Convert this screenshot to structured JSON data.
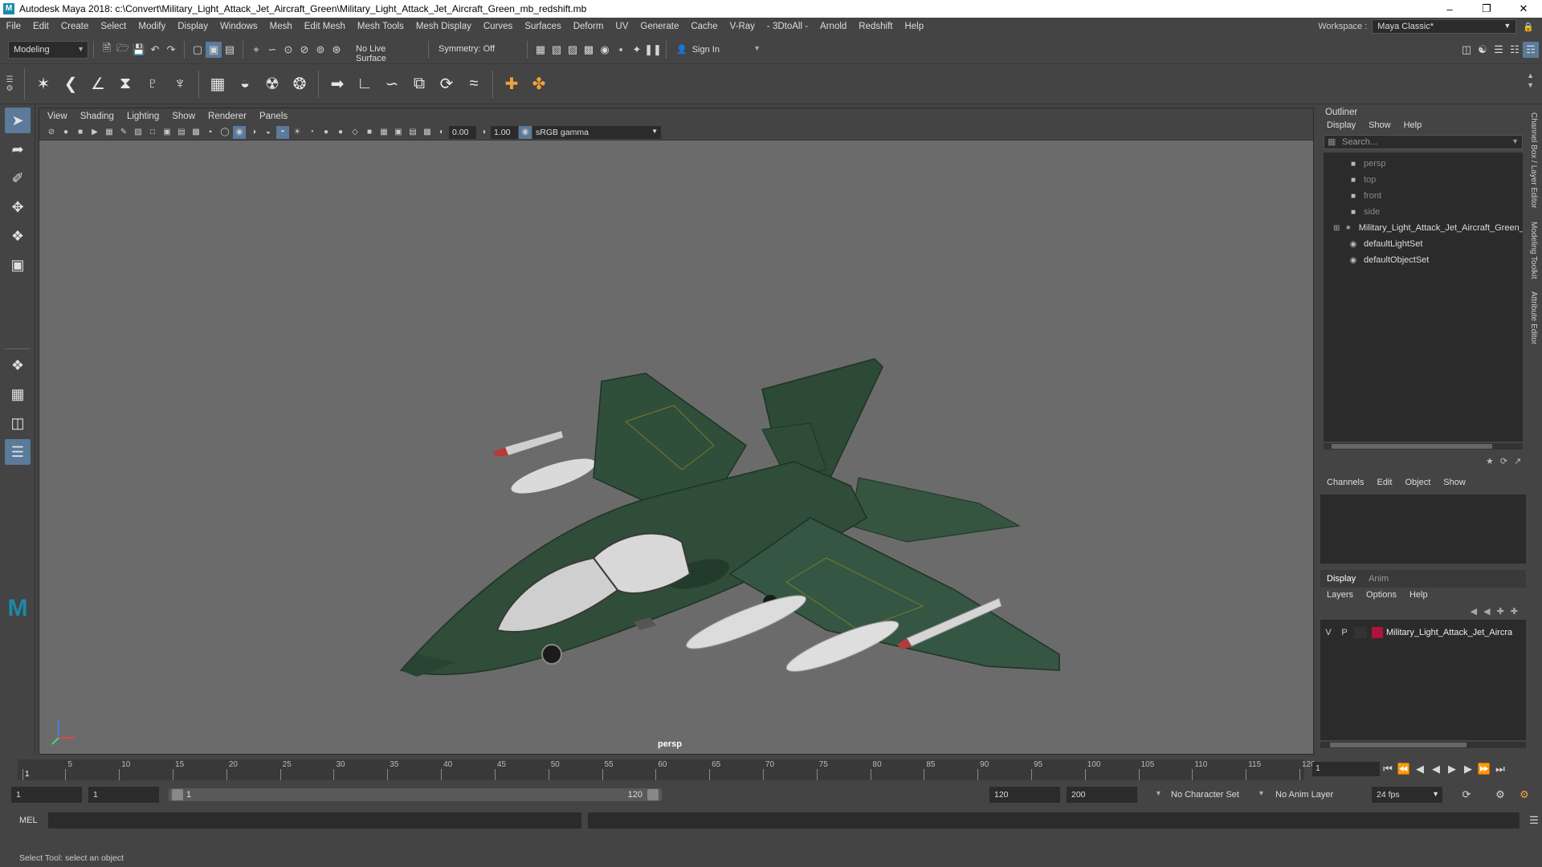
{
  "titlebar": {
    "title": "Autodesk Maya 2018: c:\\Convert\\Military_Light_Attack_Jet_Aircraft_Green\\Military_Light_Attack_Jet_Aircraft_Green_mb_redshift.mb",
    "logo": "M"
  },
  "menus": [
    "File",
    "Edit",
    "Create",
    "Select",
    "Modify",
    "Display",
    "Windows",
    "Mesh",
    "Edit Mesh",
    "Mesh Tools",
    "Mesh Display",
    "Curves",
    "Surfaces",
    "Deform",
    "UV",
    "Generate",
    "Cache",
    "V-Ray",
    "- 3DtoAll -",
    "Arnold",
    "Redshift",
    "Help"
  ],
  "workspace": {
    "label": "Workspace :",
    "value": "Maya Classic*"
  },
  "statusline": {
    "mode": "Modeling",
    "live_surface": "No Live Surface",
    "symmetry": "Symmetry: Off",
    "sign_in": "Sign In"
  },
  "viewport": {
    "menu": [
      "View",
      "Shading",
      "Lighting",
      "Show",
      "Renderer",
      "Panels"
    ],
    "exposure": "0.00",
    "gamma": "1.00",
    "color_space": "sRGB gamma",
    "camera_label": "persp"
  },
  "outliner": {
    "title": "Outliner",
    "menu": [
      "Display",
      "Show",
      "Help"
    ],
    "search_placeholder": "Search...",
    "items": [
      {
        "label": "persp",
        "dim": true,
        "icon": "camera-icon"
      },
      {
        "label": "top",
        "dim": true,
        "icon": "camera-icon"
      },
      {
        "label": "front",
        "dim": true,
        "icon": "camera-icon"
      },
      {
        "label": "side",
        "dim": true,
        "icon": "camera-icon"
      },
      {
        "label": "Military_Light_Attack_Jet_Aircraft_Green_",
        "dim": false,
        "icon": "group-icon"
      },
      {
        "label": "defaultLightSet",
        "dim": false,
        "icon": "set-icon"
      },
      {
        "label": "defaultObjectSet",
        "dim": false,
        "icon": "set-icon"
      }
    ]
  },
  "channelbox": {
    "menu": [
      "Channels",
      "Edit",
      "Object",
      "Show"
    ]
  },
  "layers": {
    "tabs": [
      "Display",
      "Anim"
    ],
    "menu": [
      "Layers",
      "Options",
      "Help"
    ],
    "layer": {
      "v": "V",
      "p": "P",
      "name": "Military_Light_Attack_Jet_Aircra",
      "color": "#b0123a"
    }
  },
  "sidetabs": [
    "Channel Box / Layer Editor",
    "Modeling Toolkit",
    "Attribute Editor"
  ],
  "timeslider": {
    "ticks": [
      "1",
      "5",
      "10",
      "15",
      "20",
      "25",
      "30",
      "35",
      "40",
      "45",
      "50",
      "55",
      "60",
      "65",
      "70",
      "75",
      "80",
      "85",
      "90",
      "95",
      "100",
      "105",
      "110",
      "115",
      "120"
    ],
    "current": "1"
  },
  "range": {
    "start": "1",
    "playback_start": "1",
    "slider_start": "1",
    "slider_end": "120",
    "playback_end": "120",
    "end": "200",
    "character_set": "No Character Set",
    "anim_layer": "No Anim Layer",
    "fps": "24 fps"
  },
  "cmdline": {
    "label": "MEL"
  },
  "helpline": {
    "text": "Select Tool: select an object"
  }
}
